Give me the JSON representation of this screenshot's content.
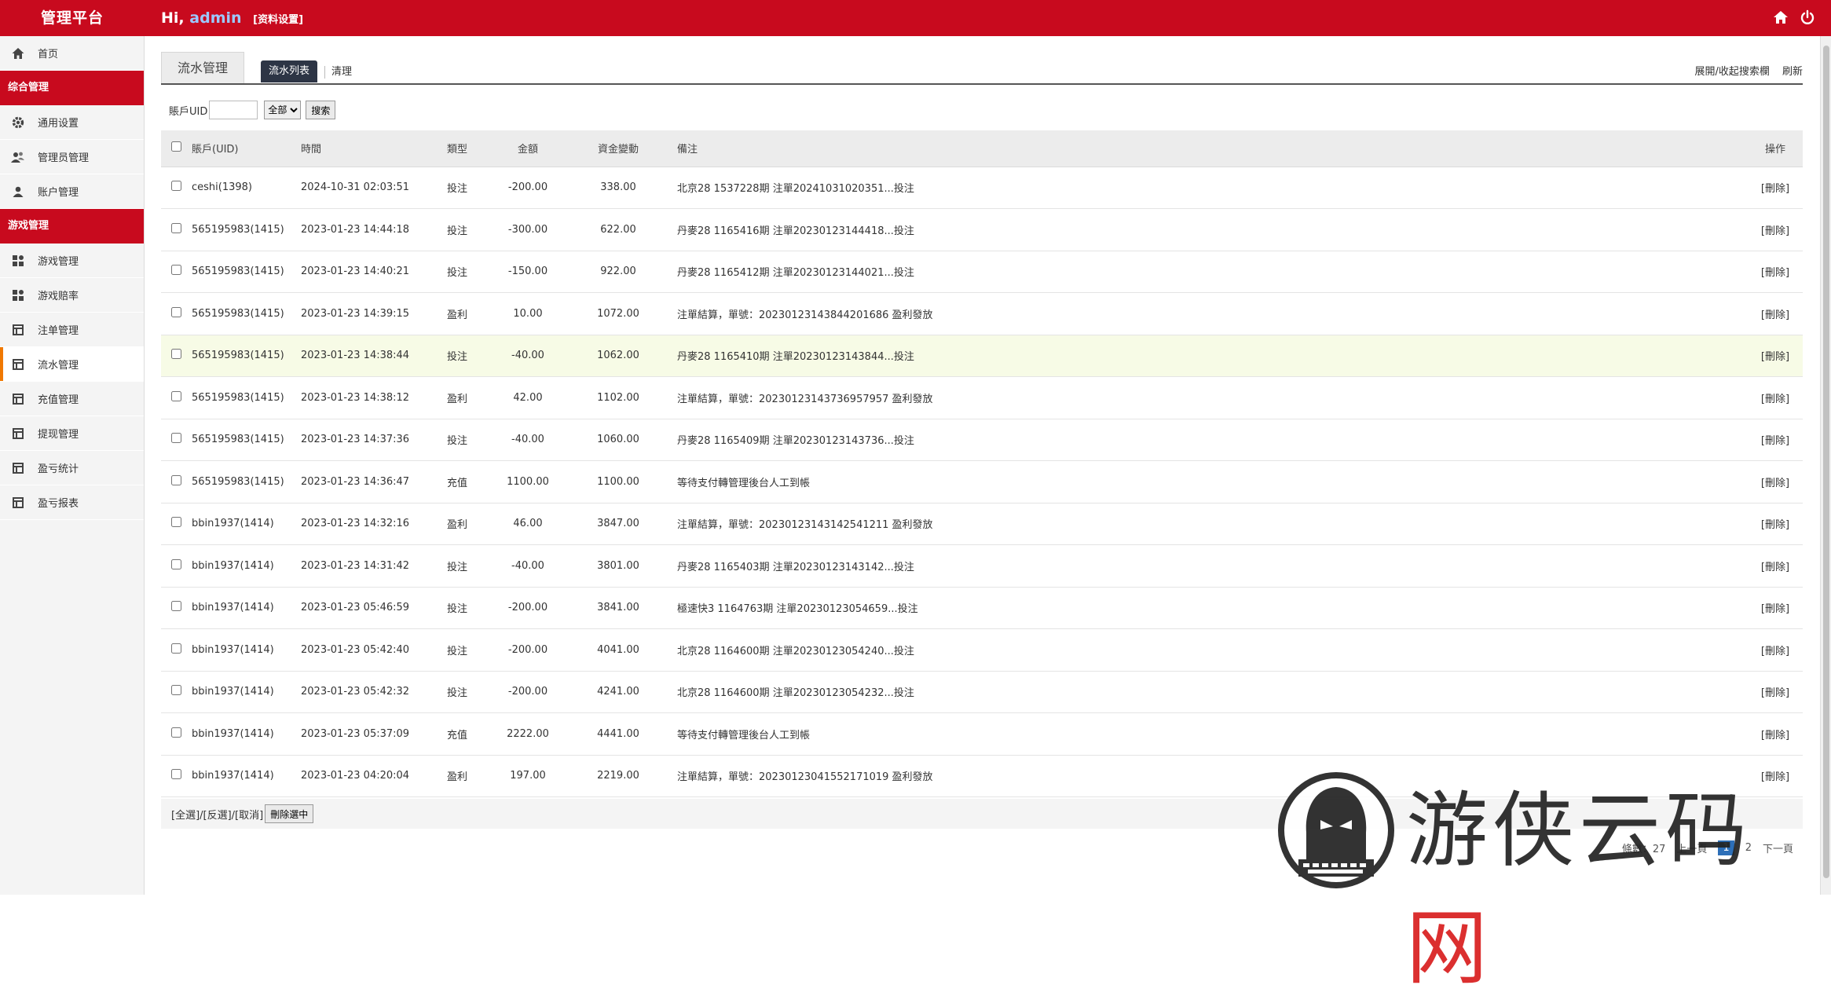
{
  "header": {
    "brand": "管理平台",
    "greeting": "Hi,",
    "username": "admin",
    "settings_link": "[资料设置]",
    "home_icon": "home-icon",
    "power_icon": "power-icon"
  },
  "sidebar": {
    "home": "首页",
    "group1": "综合管理",
    "general_settings": "通用设置",
    "admin_mgmt": "管理员管理",
    "account_mgmt": "账户管理",
    "group2": "游戏管理",
    "game_mgmt": "游戏管理",
    "game_odds": "游戏赔率",
    "bet_mgmt": "注单管理",
    "flow_mgmt": "流水管理",
    "recharge_mgmt": "充值管理",
    "withdraw_mgmt": "提现管理",
    "pl_stats": "盈亏统计",
    "pl_report": "盈亏报表"
  },
  "tabs": {
    "title": "流水管理",
    "list": "流水列表",
    "clear": "清理",
    "toggle_search": "展開/收起搜索欄",
    "refresh": "刷新"
  },
  "search": {
    "uid_label": "賬戶UID",
    "uid_value": "",
    "type_selected": "全部",
    "search_button": "搜索"
  },
  "columns": {
    "uid": "賬戶(UID)",
    "time": "時間",
    "type": "類型",
    "amount": "金額",
    "change": "資金變動",
    "note": "備注",
    "op": "操作"
  },
  "rows": [
    {
      "uid": "ceshi(1398)",
      "time": "2024-10-31 02:03:51",
      "type": "投注",
      "amount": "-200.00",
      "change": "338.00",
      "note": "北京28 1537228期 注單20241031020351...投注",
      "op": "[刪除]"
    },
    {
      "uid": "565195983(1415)",
      "time": "2023-01-23 14:44:18",
      "type": "投注",
      "amount": "-300.00",
      "change": "622.00",
      "note": "丹麥28 1165416期 注單20230123144418...投注",
      "op": "[刪除]"
    },
    {
      "uid": "565195983(1415)",
      "time": "2023-01-23 14:40:21",
      "type": "投注",
      "amount": "-150.00",
      "change": "922.00",
      "note": "丹麥28 1165412期 注單20230123144021...投注",
      "op": "[刪除]"
    },
    {
      "uid": "565195983(1415)",
      "time": "2023-01-23 14:39:15",
      "type": "盈利",
      "amount": "10.00",
      "change": "1072.00",
      "note": "注單結算，單號：20230123143844201686 盈利發放",
      "op": "[刪除]"
    },
    {
      "uid": "565195983(1415)",
      "time": "2023-01-23 14:38:44",
      "type": "投注",
      "amount": "-40.00",
      "change": "1062.00",
      "note": "丹麥28 1165410期 注單20230123143844...投注",
      "op": "[刪除]"
    },
    {
      "uid": "565195983(1415)",
      "time": "2023-01-23 14:38:12",
      "type": "盈利",
      "amount": "42.00",
      "change": "1102.00",
      "note": "注單結算，單號：20230123143736957957 盈利發放",
      "op": "[刪除]"
    },
    {
      "uid": "565195983(1415)",
      "time": "2023-01-23 14:37:36",
      "type": "投注",
      "amount": "-40.00",
      "change": "1060.00",
      "note": "丹麥28 1165409期 注單20230123143736...投注",
      "op": "[刪除]"
    },
    {
      "uid": "565195983(1415)",
      "time": "2023-01-23 14:36:47",
      "type": "充值",
      "amount": "1100.00",
      "change": "1100.00",
      "note": "等待支付轉管理後台人工到帳",
      "op": "[刪除]"
    },
    {
      "uid": "bbin1937(1414)",
      "time": "2023-01-23 14:32:16",
      "type": "盈利",
      "amount": "46.00",
      "change": "3847.00",
      "note": "注單結算，單號：20230123143142541211 盈利發放",
      "op": "[刪除]"
    },
    {
      "uid": "bbin1937(1414)",
      "time": "2023-01-23 14:31:42",
      "type": "投注",
      "amount": "-40.00",
      "change": "3801.00",
      "note": "丹麥28 1165403期 注單20230123143142...投注",
      "op": "[刪除]"
    },
    {
      "uid": "bbin1937(1414)",
      "time": "2023-01-23 05:46:59",
      "type": "投注",
      "amount": "-200.00",
      "change": "3841.00",
      "note": "極速快3 1164763期 注單20230123054659...投注",
      "op": "[刪除]"
    },
    {
      "uid": "bbin1937(1414)",
      "time": "2023-01-23 05:42:40",
      "type": "投注",
      "amount": "-200.00",
      "change": "4041.00",
      "note": "北京28 1164600期 注單20230123054240...投注",
      "op": "[刪除]"
    },
    {
      "uid": "bbin1937(1414)",
      "time": "2023-01-23 05:42:32",
      "type": "投注",
      "amount": "-200.00",
      "change": "4241.00",
      "note": "北京28 1164600期 注單20230123054232...投注",
      "op": "[刪除]"
    },
    {
      "uid": "bbin1937(1414)",
      "time": "2023-01-23 05:37:09",
      "type": "充值",
      "amount": "2222.00",
      "change": "4441.00",
      "note": "等待支付轉管理後台人工到帳",
      "op": "[刪除]"
    },
    {
      "uid": "bbin1937(1414)",
      "time": "2023-01-23 04:20:04",
      "type": "盈利",
      "amount": "197.00",
      "change": "2219.00",
      "note": "注單結算，單號：20230123041552171019 盈利發放",
      "op": "[刪除]"
    }
  ],
  "footer": {
    "select_links": "[全選]/[反選]/[取消]",
    "delete_selected": "刪除選中",
    "pager_total": "條數：27",
    "pager_prev": "上一頁",
    "pager_current": "1",
    "pager_page2": "2",
    "pager_next": "下一頁"
  },
  "watermark": {
    "text_a": "游侠云码",
    "text_b": "网"
  },
  "colors": {
    "header_red": "#c80a1e",
    "bet_green": "#2e9a2e",
    "profit_red": "#d01b1b",
    "deposit_orange": "#d39a1a"
  }
}
